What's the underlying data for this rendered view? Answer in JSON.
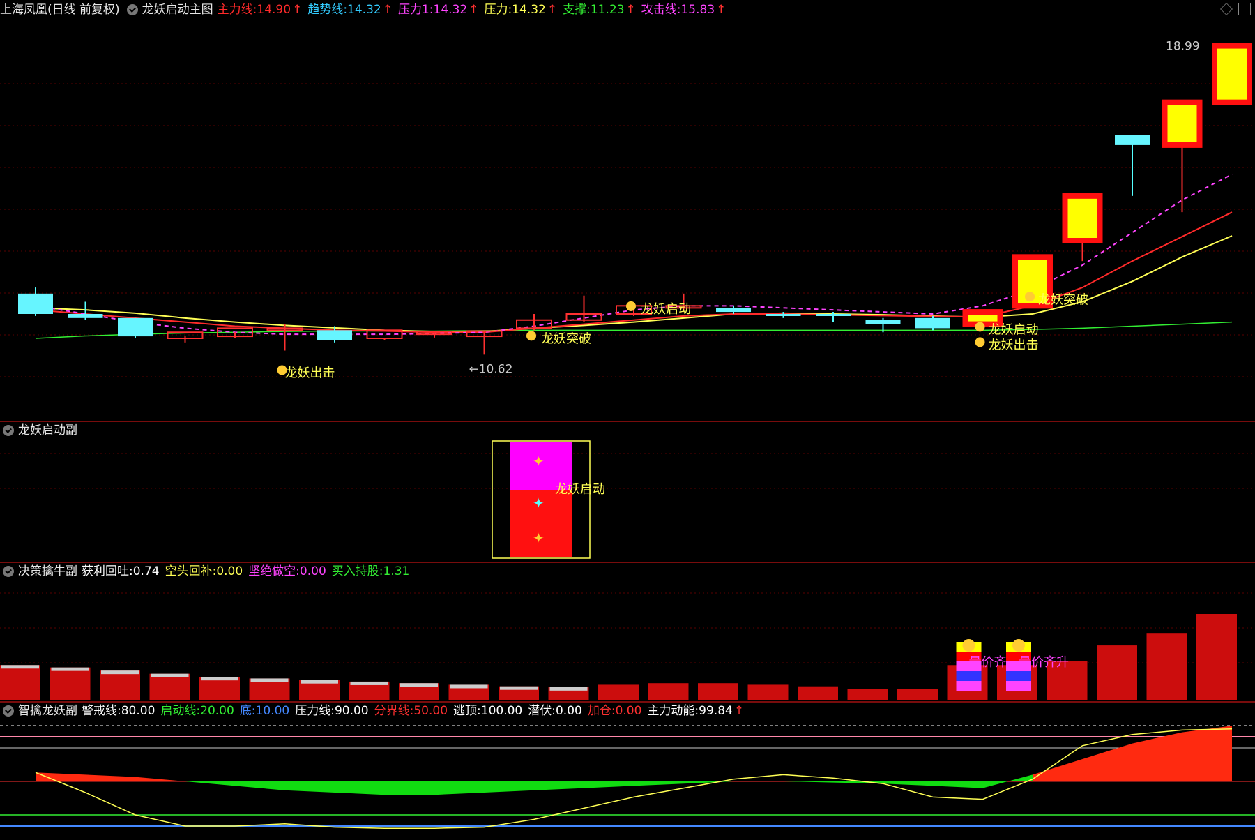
{
  "main_panel": {
    "stock_name": "上海凤凰(日线 前复权)",
    "indicator": "龙妖启动主图",
    "legend": [
      {
        "label": "主力线",
        "value": "14.90",
        "color": "#ff2a2a"
      },
      {
        "label": "趋势线",
        "value": "14.32",
        "color": "#33ccff"
      },
      {
        "label": "压力1",
        "value": "14.32",
        "color": "#ff44ff"
      },
      {
        "label": "压力",
        "value": "14.32",
        "color": "#ffff55"
      },
      {
        "label": "支撑",
        "value": "11.23",
        "color": "#33ee33"
      },
      {
        "label": "攻击线",
        "value": "15.83",
        "color": "#ff44ff"
      }
    ],
    "arrow": "↑",
    "high_label": "18.99",
    "low_label": "←10.62",
    "signals": [
      "龙妖出击",
      "龙妖突破",
      "龙妖启动",
      "龙妖启动",
      "龙妖出击",
      "龙妖突破"
    ]
  },
  "panel2": {
    "title": "龙妖启动副",
    "signal": "龙妖启动"
  },
  "panel3": {
    "title": "决策擒牛副",
    "legend": [
      {
        "label": "获利回吐",
        "value": "0.74",
        "color": "#ffffff"
      },
      {
        "label": "空头回补",
        "value": "0.00",
        "color": "#ffff55"
      },
      {
        "label": "坚绝做空",
        "value": "0.00",
        "color": "#ff44ff"
      },
      {
        "label": "买入持股",
        "value": "1.31",
        "color": "#33ee33"
      }
    ],
    "signal_texts": [
      "量价齐升",
      "量价齐升"
    ]
  },
  "panel4": {
    "title": "智擒龙妖副",
    "legend": [
      {
        "label": "警戒线",
        "value": "80.00",
        "color": "#ffffff"
      },
      {
        "label": "启动线",
        "value": "20.00",
        "color": "#33ee33"
      },
      {
        "label": "底",
        "value": "10.00",
        "color": "#4488ff"
      },
      {
        "label": "压力线",
        "value": "90.00",
        "color": "#ffffff"
      },
      {
        "label": "分界线",
        "value": "50.00",
        "color": "#ff3030"
      },
      {
        "label": "逃顶",
        "value": "100.00",
        "color": "#ffffff"
      },
      {
        "label": "潜伏",
        "value": "0.00",
        "color": "#ffffff"
      },
      {
        "label": "加仓",
        "value": "0.00",
        "color": "#ff3030"
      },
      {
        "label": "主力动能",
        "value": "99.84",
        "color": "#ffffff"
      }
    ]
  },
  "chart_data": {
    "type": "candlestick",
    "y_range": [
      10.0,
      19.6
    ],
    "candles": [
      {
        "o": 12.9,
        "h": 13.05,
        "c": 12.4,
        "l": 12.35
      },
      {
        "o": 12.4,
        "h": 12.7,
        "c": 12.3,
        "l": 12.25
      },
      {
        "o": 12.3,
        "h": 12.3,
        "c": 11.85,
        "l": 11.8
      },
      {
        "o": 11.8,
        "h": 11.85,
        "c": 11.95,
        "l": 11.7
      },
      {
        "o": 11.85,
        "h": 11.95,
        "c": 12.05,
        "l": 11.8
      },
      {
        "o": 12.05,
        "h": 12.15,
        "c": 12.05,
        "l": 11.5
      },
      {
        "o": 12.0,
        "h": 12.1,
        "c": 11.75,
        "l": 11.7
      },
      {
        "o": 11.8,
        "h": 11.8,
        "c": 12.0,
        "l": 11.75
      },
      {
        "o": 11.9,
        "h": 11.95,
        "c": 11.97,
        "l": 11.82
      },
      {
        "o": 11.85,
        "h": 11.95,
        "c": 11.98,
        "l": 11.4
      },
      {
        "o": 12.05,
        "h": 12.4,
        "c": 12.25,
        "l": 12.0
      },
      {
        "o": 12.25,
        "h": 12.85,
        "c": 12.4,
        "l": 12.2
      },
      {
        "o": 12.4,
        "h": 12.6,
        "c": 12.6,
        "l": 12.35
      },
      {
        "o": 12.6,
        "h": 12.9,
        "c": 12.6,
        "l": 12.45
      },
      {
        "o": 12.55,
        "h": 12.6,
        "c": 12.45,
        "l": 12.4
      },
      {
        "o": 12.4,
        "h": 12.45,
        "c": 12.35,
        "l": 12.3
      },
      {
        "o": 12.4,
        "h": 12.45,
        "c": 12.35,
        "l": 12.2
      },
      {
        "o": 12.25,
        "h": 12.3,
        "c": 12.15,
        "l": 11.95
      },
      {
        "o": 12.3,
        "h": 12.35,
        "c": 12.05,
        "l": 12.0
      },
      {
        "o": 12.15,
        "h": 12.5,
        "c": 12.45,
        "l": 12.05
      },
      {
        "o": 12.6,
        "h": 13.8,
        "c": 13.8,
        "l": 12.55
      },
      {
        "o": 14.2,
        "h": 15.3,
        "c": 15.3,
        "l": 13.7
      },
      {
        "o": 16.8,
        "h": 16.8,
        "c": 16.55,
        "l": 15.3
      },
      {
        "o": 16.55,
        "h": 17.6,
        "c": 17.6,
        "l": 14.9
      },
      {
        "o": 17.6,
        "h": 18.99,
        "c": 18.99,
        "l": 17.6
      }
    ],
    "lines": {
      "main_force": [
        12.5,
        12.4,
        12.3,
        12.2,
        12.1,
        12.05,
        12.0,
        11.98,
        11.95,
        11.95,
        12.05,
        12.15,
        12.25,
        12.35,
        12.4,
        12.4,
        12.38,
        12.36,
        12.34,
        12.33,
        12.6,
        13.05,
        13.7,
        14.3,
        14.9
      ],
      "trend": [
        12.55,
        12.5,
        12.42,
        12.3,
        12.2,
        12.12,
        12.06,
        12.0,
        11.97,
        11.97,
        12.05,
        12.12,
        12.2,
        12.3,
        12.4,
        12.42,
        12.4,
        12.38,
        12.35,
        12.32,
        12.4,
        12.7,
        13.2,
        13.8,
        14.32
      ],
      "support": [
        11.8,
        11.86,
        11.9,
        11.93,
        11.95,
        11.97,
        11.98,
        11.98,
        11.98,
        11.99,
        12.0,
        12.0,
        12.0,
        12.0,
        12.0,
        12.0,
        12.0,
        12.0,
        12.0,
        12.0,
        12.02,
        12.05,
        12.1,
        12.15,
        12.2
      ],
      "attack": [
        12.6,
        12.4,
        12.2,
        12.05,
        11.95,
        11.9,
        11.9,
        11.9,
        11.92,
        11.95,
        12.1,
        12.3,
        12.5,
        12.6,
        12.6,
        12.55,
        12.5,
        12.45,
        12.4,
        12.6,
        13.0,
        13.6,
        14.4,
        15.2,
        15.83
      ]
    },
    "panel3_bars": [
      0.45,
      0.42,
      0.38,
      0.34,
      0.3,
      0.28,
      0.26,
      0.24,
      0.22,
      0.2,
      0.18,
      0.17,
      0.2,
      0.22,
      0.22,
      0.2,
      0.18,
      0.15,
      0.15,
      0.45,
      0.45,
      0.5,
      0.7,
      0.85,
      1.1
    ],
    "panel4_lines": {
      "main_force_momentum": [
        58,
        56,
        54,
        50,
        46,
        42,
        40,
        38,
        38,
        40,
        42,
        44,
        46,
        48,
        50,
        50,
        49,
        48,
        46,
        44,
        56,
        70,
        84,
        94,
        99.84
      ],
      "yellow": [
        58,
        40,
        20,
        10,
        10,
        12,
        9,
        8,
        8,
        9,
        16,
        26,
        36,
        44,
        52,
        56,
        53,
        48,
        36,
        34,
        52,
        82,
        92,
        96,
        97
      ]
    }
  }
}
